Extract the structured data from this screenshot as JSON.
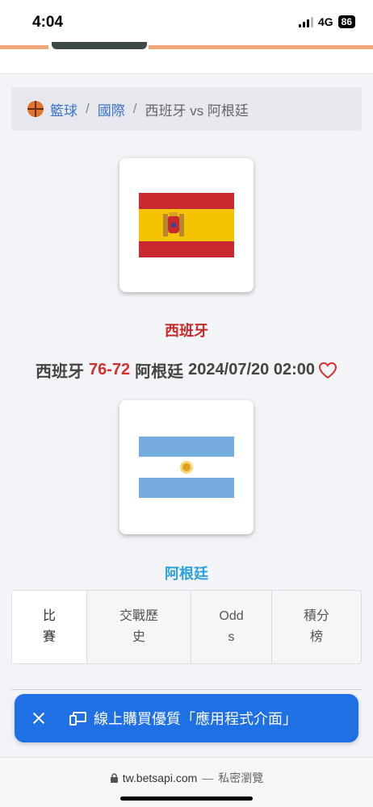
{
  "status_bar": {
    "time": "4:04",
    "network": "4G",
    "battery": "86"
  },
  "breadcrumb": {
    "sport": "籃球",
    "region": "國際",
    "separator": "/",
    "current": "西班牙 vs 阿根廷"
  },
  "match": {
    "home_team": "西班牙",
    "away_team": "阿根廷",
    "score": "76-72",
    "datetime": "2024/07/20 02:00"
  },
  "tabs": [
    {
      "label": "比\n賽",
      "active": true
    },
    {
      "label": "交戰歷\n史",
      "active": false
    },
    {
      "label": "Odd\ns",
      "active": false
    },
    {
      "label": "積分\n榜",
      "active": false
    }
  ],
  "app_banner": {
    "text": "線上購買優質「應用程式介面」"
  },
  "browser": {
    "url": "tw.betsapi.com",
    "separator": "—",
    "mode": "私密瀏覽"
  },
  "colors": {
    "home": "#c62828",
    "away": "#2aa0e0",
    "score": "#d32f2f",
    "banner": "#1f6fe5"
  },
  "icons": [
    "basketball-icon",
    "heart-icon",
    "close-icon",
    "devices-icon",
    "lock-icon",
    "spain-flag",
    "argentina-flag"
  ]
}
